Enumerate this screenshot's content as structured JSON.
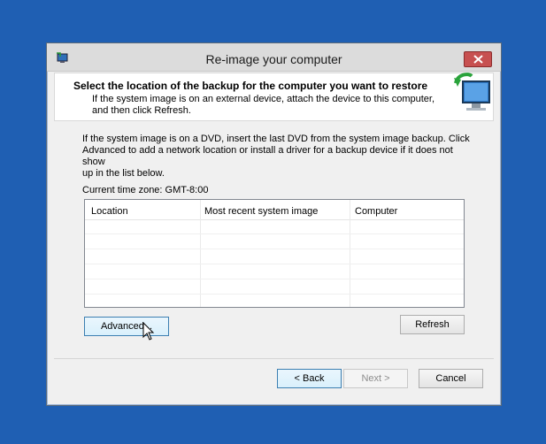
{
  "window": {
    "title": "Re-image your computer",
    "app_icon": "system-restore-icon",
    "close_icon": "close-icon"
  },
  "header": {
    "title": "Select the location of the backup for the computer you want to restore",
    "description_line1": "If the system image is on an external device, attach the device to this computer,",
    "description_line2": "and then click Refresh.",
    "icon": "restore-monitor-icon"
  },
  "body": {
    "intro_line1": "If the system image is on a DVD, insert the last DVD from the system image backup. Click",
    "intro_line2": "Advanced to add a network location or install a driver for a backup device if it does not show",
    "intro_line3": "up in the list below.",
    "timezone": "Current time zone: GMT-8:00"
  },
  "list": {
    "columns": [
      "Location",
      "Most recent system image",
      "Computer"
    ],
    "rows": []
  },
  "buttons": {
    "advanced": "Advanced...",
    "refresh": "Refresh",
    "back": "< Back",
    "next": "Next >",
    "cancel": "Cancel"
  },
  "colors": {
    "desktop": "#1f5fb3",
    "close_button": "#c75050",
    "focus_border": "#3c7fb1"
  }
}
